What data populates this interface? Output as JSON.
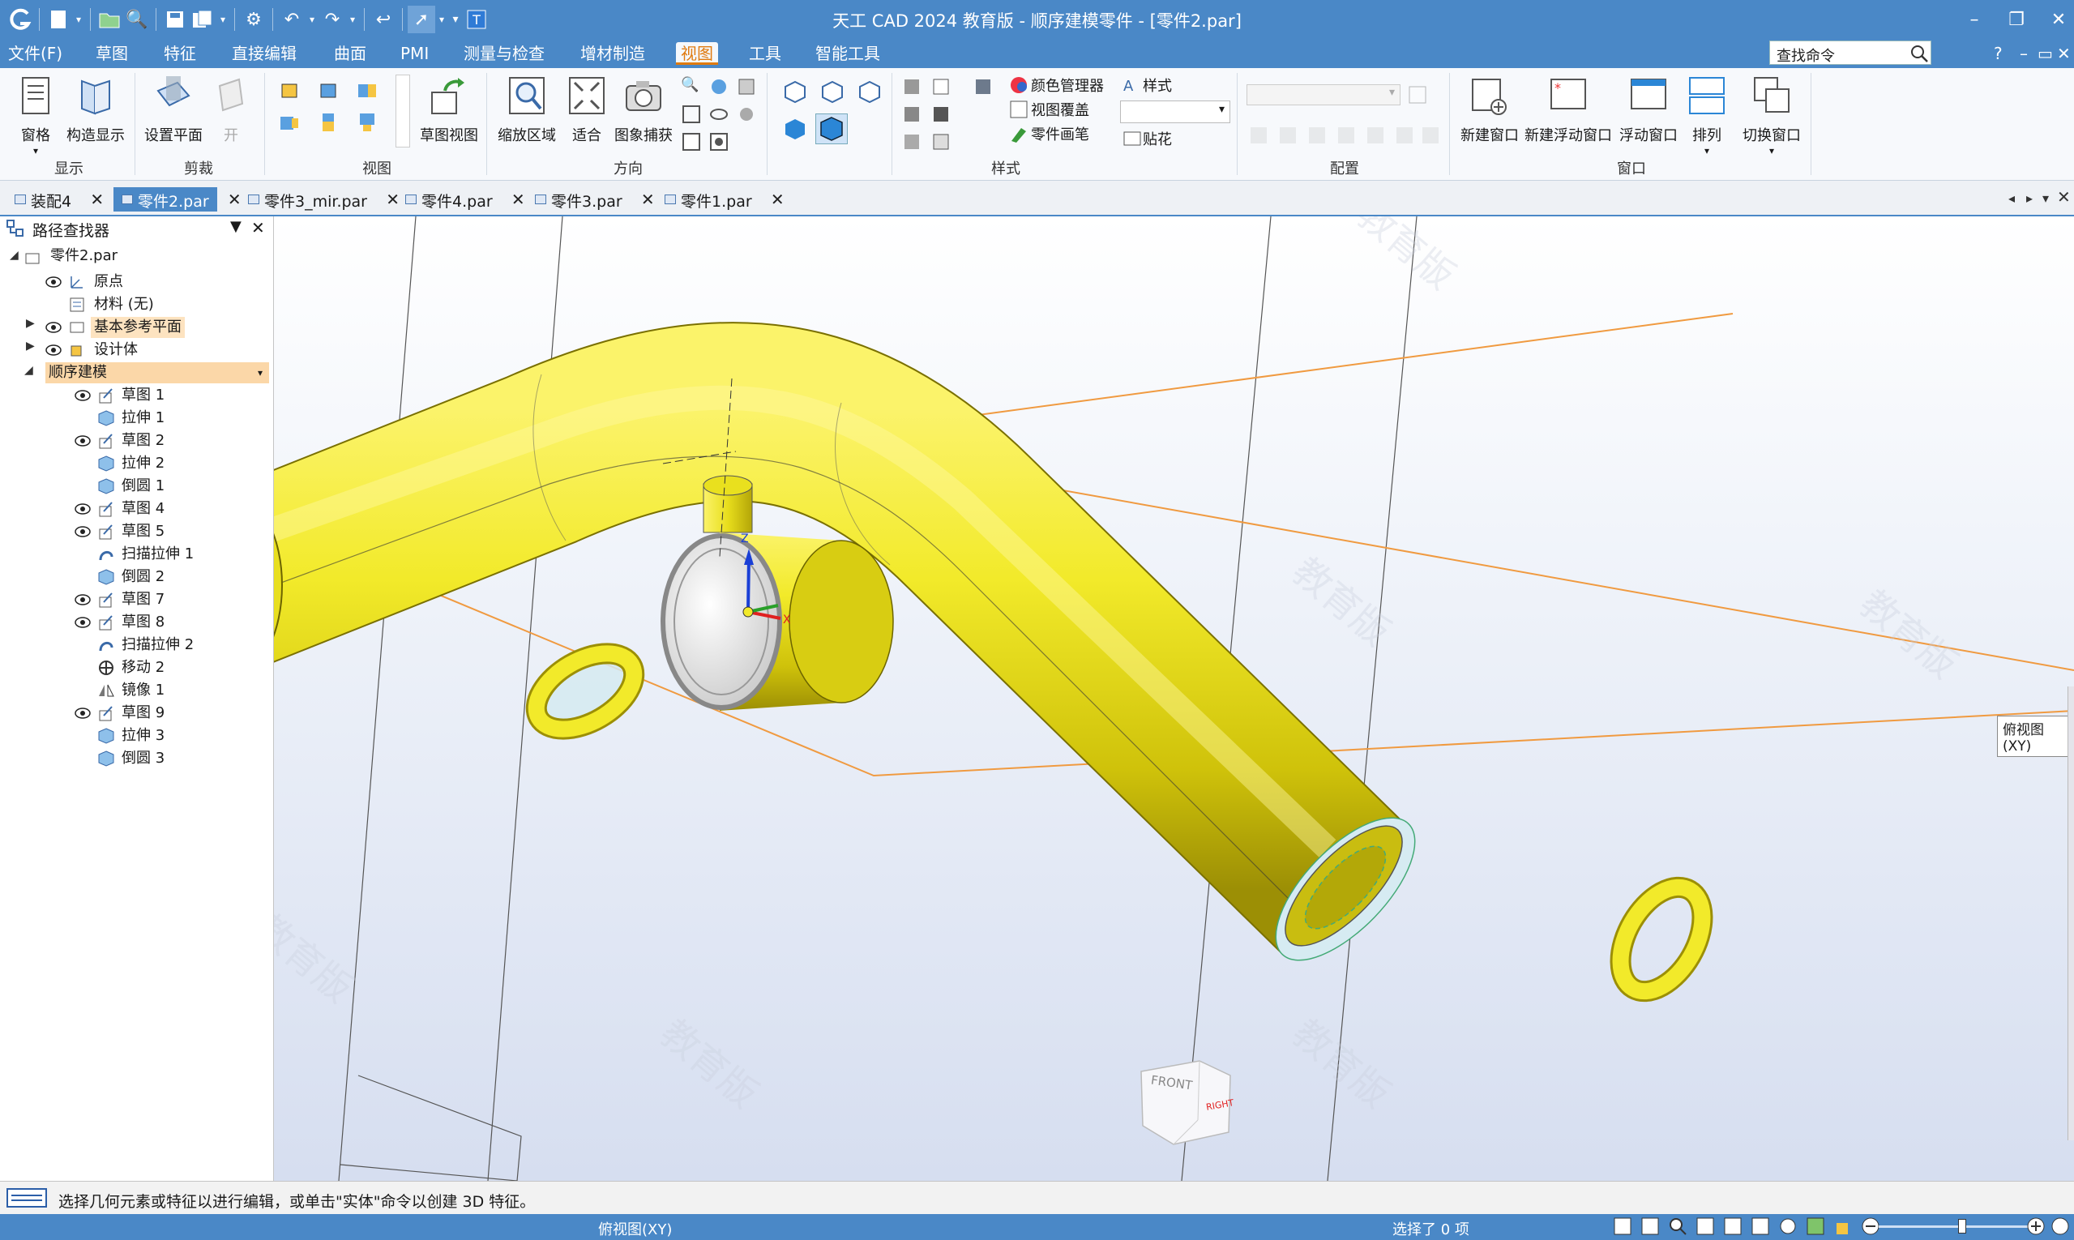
{
  "app": {
    "title": "天工 CAD 2024 教育版 - 顺序建模零件 - [零件2.par]"
  },
  "menu": {
    "items": [
      "文件(F)",
      "草图",
      "特征",
      "直接编辑",
      "曲面",
      "PMI",
      "测量与检查",
      "增材制造",
      "视图",
      "工具",
      "智能工具"
    ],
    "active_index": 8,
    "search_placeholder": "查找命令",
    "right_controls": [
      "?",
      "–",
      "▭",
      "✕"
    ]
  },
  "ribbon": {
    "groups": [
      {
        "label": "显示",
        "buttons": [
          "窗格",
          "构造显示"
        ]
      },
      {
        "label": "剪裁",
        "buttons": [
          "设置平面",
          "开"
        ]
      },
      {
        "label": "视图",
        "buttons": [
          "草图视图"
        ]
      },
      {
        "label": "方向",
        "buttons": [
          "缩放区域",
          "适合",
          "图象捕获"
        ]
      },
      {
        "label": "样式",
        "buttons": [
          "颜色管理器",
          "视图覆盖",
          "零件画笔",
          "样式",
          "贴花"
        ]
      },
      {
        "label": "配置",
        "buttons": []
      },
      {
        "label": "窗口",
        "buttons": [
          "新建窗口",
          "新建浮动窗口",
          "浮动窗口",
          "排列",
          "切换窗口"
        ]
      }
    ]
  },
  "doc_tabs": [
    {
      "label": "装配4",
      "active": false
    },
    {
      "label": "零件2.par",
      "active": true
    },
    {
      "label": "零件3_mir.par",
      "active": false
    },
    {
      "label": "零件4.par",
      "active": false
    },
    {
      "label": "零件3.par",
      "active": false
    },
    {
      "label": "零件1.par",
      "active": false
    }
  ],
  "pathfinder": {
    "title": "路径查找器",
    "root": "零件2.par",
    "nodes": [
      "原点",
      "材料 (无)",
      "基本参考平面",
      "设计体",
      "顺序建模"
    ],
    "features": [
      "草图 1",
      "拉伸 1",
      "草图 2",
      "拉伸 2",
      "倒圆 1",
      "草图 4",
      "草图 5",
      "扫描拉伸 1",
      "倒圆 2",
      "草图 7",
      "草图 8",
      "扫描拉伸 2",
      "移动 2",
      "镜像 1",
      "草图 9",
      "拉伸 3",
      "倒圆 3"
    ]
  },
  "viewport": {
    "view_tip": "俯视图(XY)",
    "watermark": "教育版",
    "cube_front": "FRONT",
    "cube_right": "RIGHT",
    "axis_z": "Z",
    "axis_x": "X"
  },
  "prompt": {
    "text": "选择几何元素或特征以进行编辑，或单击\"实体\"命令以创建 3D 特征。"
  },
  "status": {
    "view_name": "俯视图(XY)",
    "selection": "选择了 0 项"
  },
  "colors": {
    "accent": "#4a88c7",
    "part_yellow": "#f2ea2a",
    "active_tab_orange": "#e07b10"
  }
}
